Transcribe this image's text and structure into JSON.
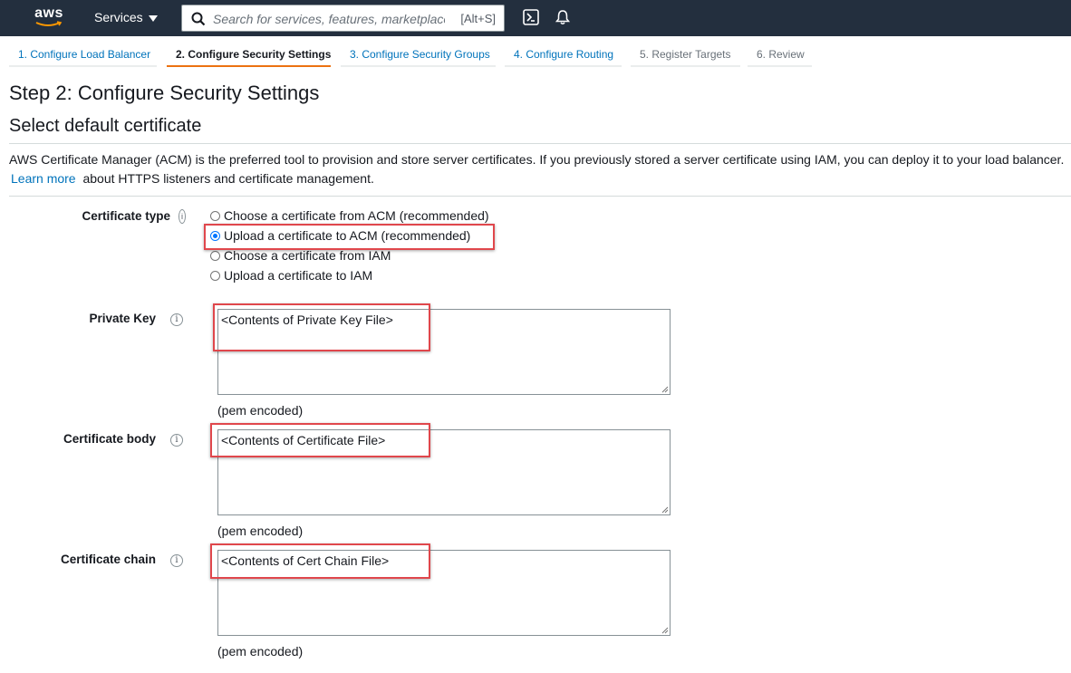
{
  "topnav": {
    "logo_text": "aws",
    "services_label": "Services",
    "search_placeholder": "Search for services, features, marketplace products, and docs",
    "search_shortcut": "[Alt+S]",
    "icons": [
      "terminal-icon",
      "bell-icon"
    ]
  },
  "wizard": {
    "tabs": [
      {
        "label": "1. Configure Load Balancer",
        "state": "link"
      },
      {
        "label": "2. Configure Security Settings",
        "state": "active"
      },
      {
        "label": "3. Configure Security Groups",
        "state": "link"
      },
      {
        "label": "4. Configure Routing",
        "state": "link"
      },
      {
        "label": "5. Register Targets",
        "state": "disabled"
      },
      {
        "label": "6. Review",
        "state": "disabled"
      }
    ]
  },
  "page": {
    "title": "Step 2: Configure Security Settings",
    "section_title": "Select default certificate",
    "description_text": "AWS Certificate Manager (ACM) is the preferred tool to provision and store server certificates. If you previously stored a server certificate using IAM, you can deploy it to your load balancer.",
    "learn_more": "Learn more",
    "description_tail": "about HTTPS listeners and certificate management."
  },
  "form": {
    "certificate_type": {
      "label": "Certificate type",
      "options": [
        {
          "label": "Choose a certificate from ACM (recommended)",
          "checked": false
        },
        {
          "label": "Upload a certificate to ACM (recommended)",
          "checked": true
        },
        {
          "label": "Choose a certificate from IAM",
          "checked": false
        },
        {
          "label": "Upload a certificate to IAM",
          "checked": false
        }
      ]
    },
    "private_key": {
      "label": "Private Key",
      "value": "<Contents of Private Key File>",
      "hint": "(pem encoded)"
    },
    "certificate_body": {
      "label": "Certificate body",
      "value": "<Contents of Certificate File>",
      "hint": "(pem encoded)"
    },
    "certificate_chain": {
      "label": "Certificate chain",
      "value": "<Contents of Cert Chain File>",
      "hint": "(pem encoded)"
    }
  },
  "colors": {
    "nav_bg": "#232f3e",
    "link": "#0073bb",
    "active_tab_underline": "#ec7211",
    "highlight_box": "#e0474c"
  }
}
